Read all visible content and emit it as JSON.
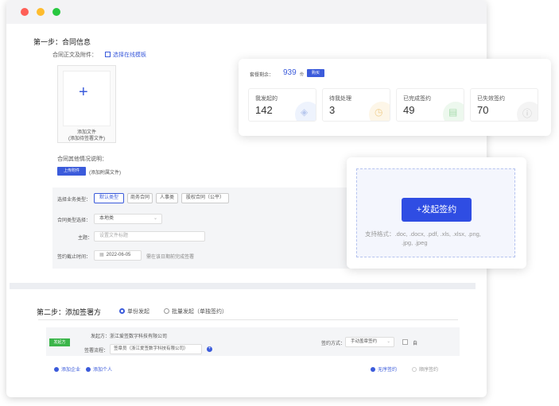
{
  "step1": {
    "title": "第一步：合同信息",
    "attachment_label": "合同正文及附件：",
    "online_template_link": "选择在线模板",
    "add_file_line1": "添加文件",
    "add_file_line2": "(添加待签署文件)",
    "other_info_label": "合同其他情况说明：",
    "upload_button": "上传附件",
    "upload_hint": "(添加附属文件)",
    "business_type_label": "选择业务类型：",
    "business_types": [
      "默认类型",
      "商务合同",
      "人事类",
      "股权合同（公平）"
    ],
    "contract_type_label": "合同类型选择：",
    "contract_type_value": "本地类",
    "subject_label": "主题：",
    "subject_placeholder": "设置文件标题",
    "deadline_label": "签约截止时间：",
    "deadline_value": "2022-06-05",
    "deadline_hint": "需在该日期前完成签署"
  },
  "step2": {
    "title": "第二步：添加签署方",
    "mode_single": "单份发起",
    "mode_batch": "批量发起（单独签约）",
    "initiator_badge": "发起方",
    "initiator_label": "发起方：",
    "initiator_value": "浙江爱签数字科技有限公司",
    "sign_process_label": "签署流程：",
    "sign_process_value": "签章员（浙江爱签数字科技有限公司）",
    "sign_method_label": "签约方式：",
    "sign_method_value": "手动盖章签约",
    "self_label": "自",
    "add_company": "添加企业",
    "add_person": "添加个人",
    "order_parallel": "无序签约",
    "order_sequential": "顺序签约"
  },
  "stats_card": {
    "remaining_label": "套餐剩余：",
    "remaining_value": "939",
    "remaining_unit": "份",
    "buy_button": "购买",
    "stats": [
      {
        "label": "我发起的",
        "value": "142"
      },
      {
        "label": "待我处理",
        "value": "3"
      },
      {
        "label": "已完成签约",
        "value": "49"
      },
      {
        "label": "已失效签约",
        "value": "70"
      }
    ]
  },
  "launch_card": {
    "button_label": "+发起签约",
    "formats_line1": "支持格式：.doc, .docx, .pdf, .xls, .xlsx, .png,",
    "formats_line2": ".jpg, .jpeg"
  },
  "colors": {
    "accent": "#2f4de3",
    "badge_green": "#3bb54a"
  }
}
